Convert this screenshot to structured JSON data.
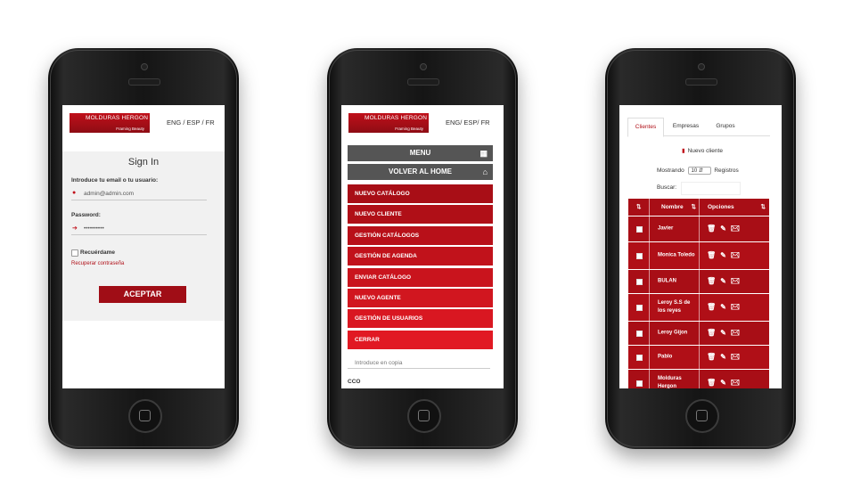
{
  "phone1": {
    "logo_top": "MOLDURAS HERGON",
    "logo_bottom": "Framing Beauty",
    "languages": "ENG / ESP / FR",
    "title": "Sign In",
    "email_label": "Introduce tu email o tu usuario:",
    "email_value": "admin@admin.com",
    "password_label": "Password:",
    "password_value": "••••••••••",
    "remember_label": "Recuérdame",
    "recover_link": "Recuperar contraseña",
    "submit_label": "ACEPTAR"
  },
  "phone2": {
    "logo_top": "MOLDURAS HERGON",
    "logo_bottom": "Framing Beauty",
    "languages": "ENG/ ESP/ FR",
    "menu_label": "MENU",
    "home_label": "VOLVER AL HOME",
    "items": [
      {
        "label": "NUEVO CATÁLOGO",
        "color": "#a80e16"
      },
      {
        "label": "NUEVO CLIENTE",
        "color": "#b00f17"
      },
      {
        "label": "GESTIÓN CATÁLOGOS",
        "color": "#b81019"
      },
      {
        "label": "GESTIÓN DE AGENDA",
        "color": "#c1121b"
      },
      {
        "label": "ENVIAR CATÁLOGO",
        "color": "#c9141d"
      },
      {
        "label": "NUEVO AGENTE",
        "color": "#d1161f"
      },
      {
        "label": "GESTIÓN DE USUARIOS",
        "color": "#d91721"
      },
      {
        "label": "CERRAR",
        "color": "#e11923"
      }
    ],
    "copy_placeholder": "Introduce en copia",
    "cco_label": "CCO"
  },
  "phone3": {
    "tabs": [
      "Clientes",
      "Empresas",
      "Grupos"
    ],
    "new_client": "Nuevo cliente",
    "showing_label": "Mostrando",
    "page_size": "10",
    "records_label": "Registros",
    "search_label": "Buscar:",
    "col_name": "Nombre",
    "col_options": "Opciones",
    "rows": [
      {
        "name": "Javier"
      },
      {
        "name": "Monica Toledo"
      },
      {
        "name": "BULAN"
      },
      {
        "name": "Leroy S.S de los reyes"
      },
      {
        "name": "Leroy Gijon"
      },
      {
        "name": "Pablo"
      },
      {
        "name": "Molduras Hergon"
      }
    ]
  },
  "colors": {
    "brand_red": "#a80e16",
    "menu_gray": "#555555"
  }
}
